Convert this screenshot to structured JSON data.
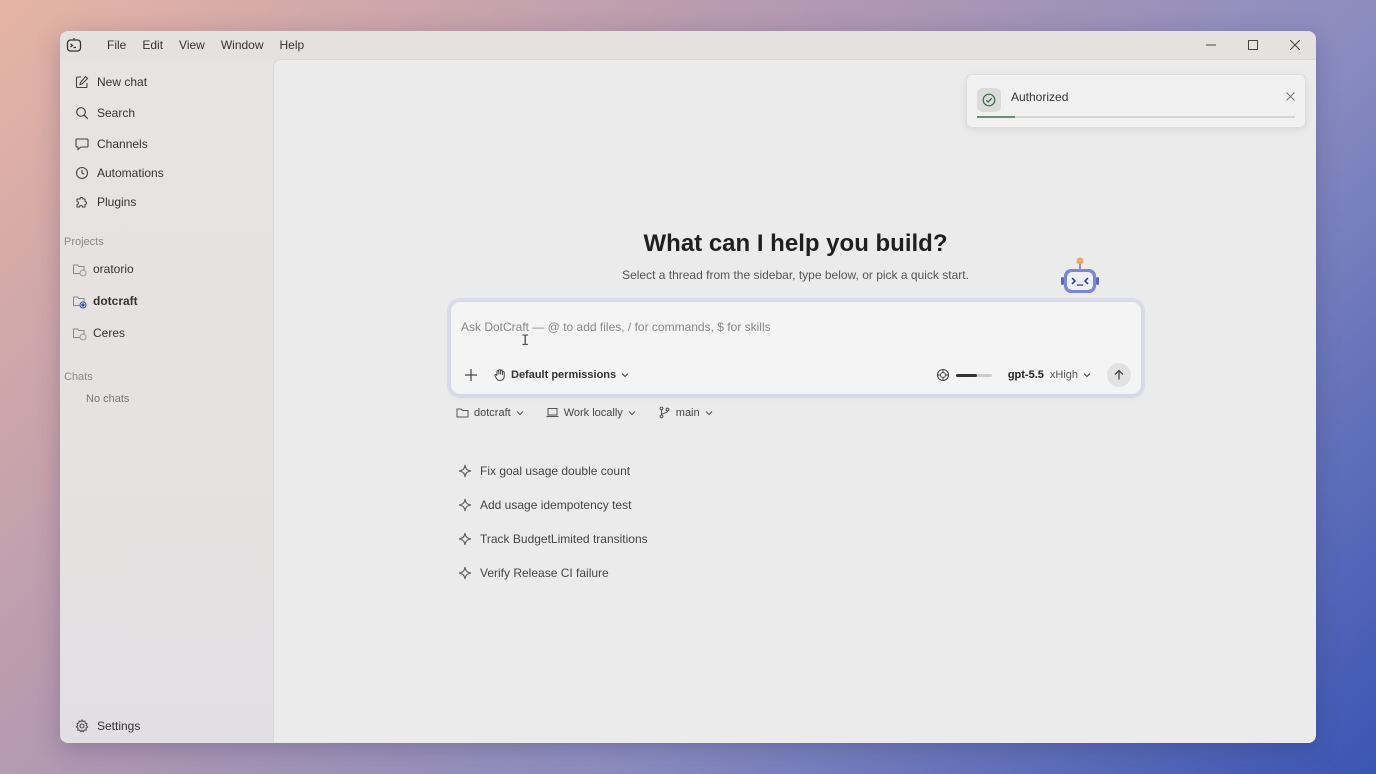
{
  "menu": [
    "File",
    "Edit",
    "View",
    "Window",
    "Help"
  ],
  "sidebar": {
    "nav": [
      {
        "label": "New chat",
        "icon": "edit-icon"
      },
      {
        "label": "Search",
        "icon": "search-icon"
      },
      {
        "label": "Channels",
        "icon": "chat-bubble-icon"
      },
      {
        "label": "Automations",
        "icon": "clock-icon"
      },
      {
        "label": "Plugins",
        "icon": "puzzle-icon"
      }
    ],
    "projects_label": "Projects",
    "projects": [
      {
        "label": "oratorio",
        "active": false
      },
      {
        "label": "dotcraft",
        "active": true
      },
      {
        "label": "Ceres",
        "active": false
      }
    ],
    "chats_label": "Chats",
    "no_chats": "No chats",
    "settings_label": "Settings"
  },
  "main": {
    "title": "What can I help you build?",
    "subtitle": "Select a thread from the sidebar, type below, or pick a quick start.",
    "composer": {
      "placeholder": "Ask DotCraft — @ to add files, / for commands, $ for skills",
      "permissions_label": "Default permissions",
      "context_usage": 0.6,
      "model": "gpt-5.5",
      "effort": "xHigh"
    },
    "context": {
      "project": "dotcraft",
      "location": "Work locally",
      "branch": "main"
    },
    "quick_starts": [
      "Fix goal usage double count",
      "Add usage idempotency test",
      "Track BudgetLimited transitions",
      "Verify Release CI failure"
    ]
  },
  "toast": {
    "message": "Authorized",
    "progress": 0.12
  },
  "colors": {
    "accent": "#3a55b4",
    "toast_success": "#6a8f74",
    "robot_accent": "#5a66c8"
  }
}
